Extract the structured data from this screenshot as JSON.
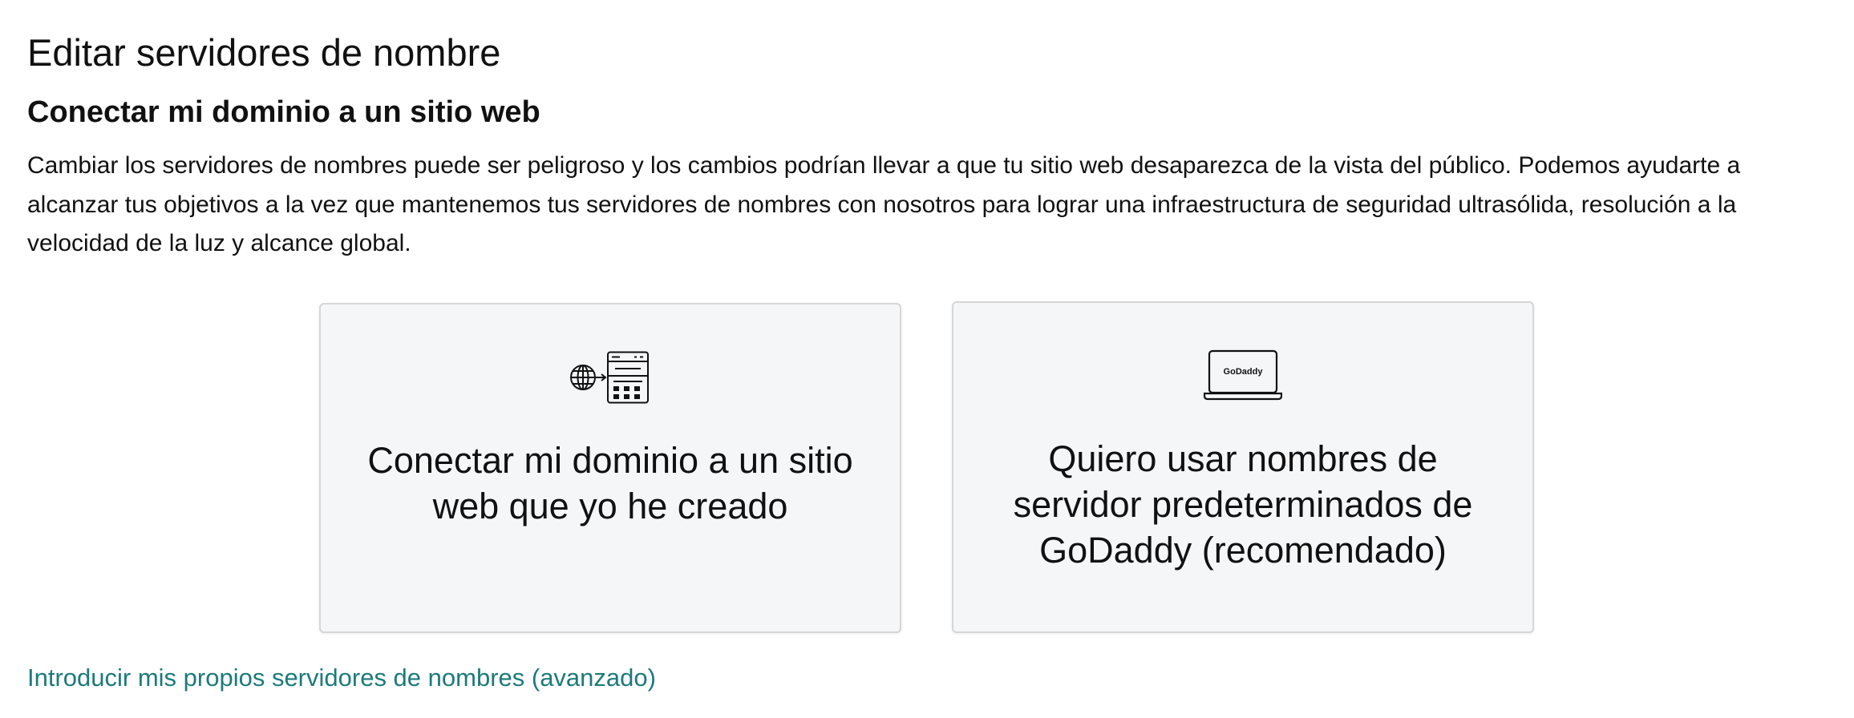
{
  "header": {
    "title": "Editar servidores de nombre"
  },
  "section": {
    "title": "Conectar mi dominio a un sitio web",
    "description": "Cambiar los servidores de nombres puede ser peligroso y los cambios podrían llevar a que tu sitio web desaparezca de la vista del público. Podemos ayudarte a alcanzar tus objetivos a la vez que mantenemos tus servidores de nombres con nosotros para lograr una infraestructura de seguridad ultrasólida, resolución a la velocidad de la luz y alcance global."
  },
  "options": [
    {
      "icon": "globe-to-website-icon",
      "label": "Conectar mi dominio a un sitio web que yo he creado"
    },
    {
      "icon": "godaddy-laptop-icon",
      "icon_text": "GoDaddy",
      "label": "Quiero usar nombres de servidor predeterminados de GoDaddy (recomendado)"
    }
  ],
  "links": {
    "advanced": "Introducir mis propios servidores de nombres (avanzado)"
  },
  "colors": {
    "link": "#1d7a7a",
    "card_background": "#f5f6f8",
    "card_border": "#d6d6d6",
    "text": "#111111"
  }
}
